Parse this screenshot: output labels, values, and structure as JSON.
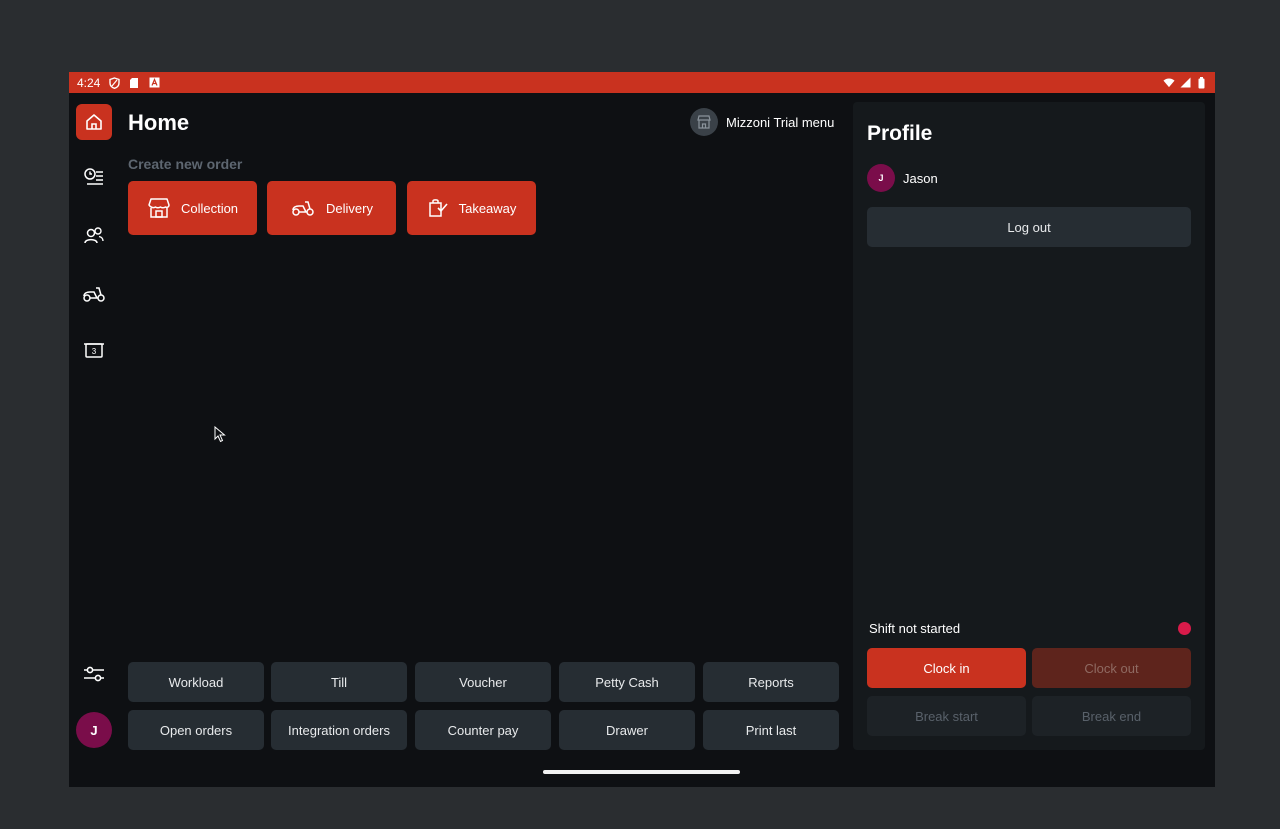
{
  "status_bar": {
    "time": "4:24"
  },
  "page": {
    "title": "Home",
    "section_label": "Create new order"
  },
  "menu": {
    "name": "Mizzoni Trial menu"
  },
  "order_types": [
    {
      "label": "Collection",
      "icon": "storefront-icon"
    },
    {
      "label": "Delivery",
      "icon": "scooter-icon"
    },
    {
      "label": "Takeaway",
      "icon": "bag-check-icon"
    }
  ],
  "sidebar": {
    "items": [
      {
        "name": "home",
        "icon": "home-icon"
      },
      {
        "name": "orders",
        "icon": "clock-list-icon"
      },
      {
        "name": "customers",
        "icon": "users-icon"
      },
      {
        "name": "delivery",
        "icon": "scooter-icon"
      },
      {
        "name": "counter",
        "icon": "ticket-icon"
      }
    ],
    "settings_icon": "sliders-icon",
    "avatar_initial": "J"
  },
  "tiles": {
    "row1": [
      "Workload",
      "Till",
      "Voucher",
      "Petty Cash",
      "Reports"
    ],
    "row2": [
      "Open orders",
      "Integration orders",
      "Counter pay",
      "Drawer",
      "Print last"
    ]
  },
  "profile": {
    "title": "Profile",
    "user_initial": "J",
    "user_name": "Jason",
    "logout_label": "Log out",
    "shift_status": "Shift not started",
    "clock_in_label": "Clock in",
    "clock_out_label": "Clock out",
    "break_start_label": "Break start",
    "break_end_label": "Break end"
  },
  "colors": {
    "accent": "#c9321f",
    "background": "#0e1013",
    "panel": "#15191c",
    "tile": "#262d33",
    "avatar": "#7a0d4a",
    "status_dot": "#d81b4a"
  }
}
